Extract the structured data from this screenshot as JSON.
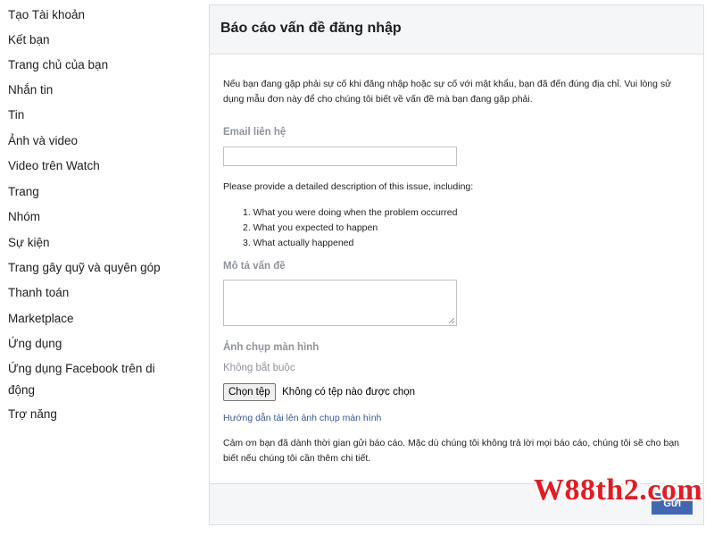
{
  "sidebar": {
    "items": [
      {
        "label": "Tạo Tài khoản"
      },
      {
        "label": "Kết bạn"
      },
      {
        "label": "Trang chủ của bạn"
      },
      {
        "label": "Nhắn tin"
      },
      {
        "label": "Tin"
      },
      {
        "label": "Ảnh và video"
      },
      {
        "label": "Video trên Watch"
      },
      {
        "label": "Trang"
      },
      {
        "label": "Nhóm"
      },
      {
        "label": "Sự kiện"
      },
      {
        "label": "Trang gây quỹ và quyên góp"
      },
      {
        "label": "Thanh toán"
      },
      {
        "label": "Marketplace"
      },
      {
        "label": "Ứng dụng"
      },
      {
        "label": "Ứng dụng Facebook trên di động"
      },
      {
        "label": "Trợ năng"
      }
    ]
  },
  "form": {
    "title": "Báo cáo vấn đề đăng nhập",
    "intro": "Nếu bạn đang gặp phải sự cố khi đăng nhập hoặc sự cố với mật khẩu, bạn đã đến đúng địa chỉ. Vui lòng sử dụng mẫu đơn này để cho chúng tôi biết về vấn đề mà bạn đang gặp phải.",
    "email_label": "Email liên hệ",
    "email_value": "",
    "description_prompt": "Please provide a detailed description of this issue, including:",
    "steps": [
      "1. What you were doing when the problem occurred",
      "2. What you expected to happen",
      "3. What actually happened"
    ],
    "problem_label": "Mô tả vấn đề",
    "problem_value": "",
    "screenshot_label": "Ảnh chụp màn hình",
    "optional_label": "Không bắt buộc",
    "file_button_label": "Chọn tệp",
    "file_status": "Không có tệp nào được chọn",
    "guide_link": "Hướng dẫn tải lên ảnh chụp màn hình",
    "thanks_text": "Cảm ơn bạn đã dành thời gian gửi báo cáo. Mặc dù chúng tôi không trả lời mọi báo cáo, chúng tôi sẽ cho bạn biết nếu chúng tôi cần thêm chi tiết.",
    "submit_label": "Gửi"
  },
  "watermark": {
    "text": "W88th2.com"
  },
  "colors": {
    "link": "#385898",
    "primary_button": "#4267b2",
    "watermark": "#e31b23",
    "label_gray": "#90949c"
  }
}
